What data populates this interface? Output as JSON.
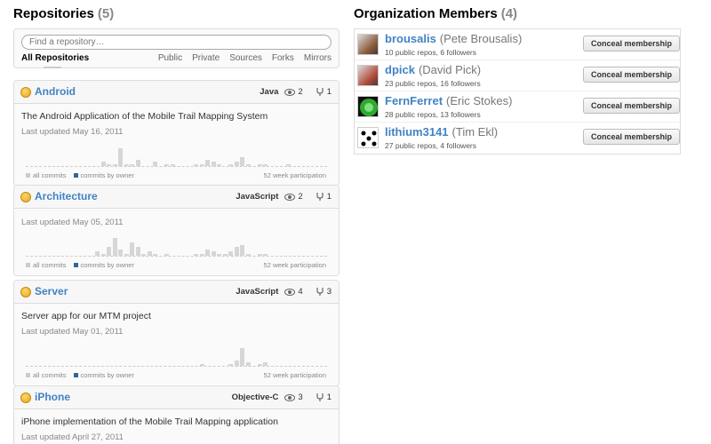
{
  "repositories": {
    "title": "Repositories",
    "count": "(5)",
    "filter_placeholder": "Find a repository…",
    "tabs": {
      "all": "All Repositories",
      "others": [
        "Public",
        "Private",
        "Sources",
        "Forks",
        "Mirrors"
      ]
    },
    "legend_all": "all commits",
    "legend_owner": "commits by owner",
    "participation_label": "52 week participation",
    "items": [
      {
        "name": "Android",
        "language": "Java",
        "watchers": "2",
        "forks": "1",
        "description": "The Android Application of the Mobile Trail Mapping System",
        "updated": "Last updated May 16, 2011",
        "participation": [
          0,
          0,
          0,
          0,
          0,
          0,
          0,
          0,
          0,
          0,
          0,
          0,
          0,
          2,
          1,
          1,
          8,
          1,
          1,
          3,
          0,
          0,
          2,
          0,
          1,
          1,
          0,
          0,
          0,
          1,
          1,
          3,
          2,
          1,
          0,
          1,
          2,
          4,
          1,
          0,
          1,
          1,
          0,
          0,
          0,
          1,
          0,
          0,
          0,
          0,
          0,
          0
        ]
      },
      {
        "name": "Architecture",
        "language": "JavaScript",
        "watchers": "2",
        "forks": "1",
        "description": "",
        "updated": "Last updated May 05, 2011",
        "participation": [
          0,
          0,
          0,
          0,
          0,
          0,
          0,
          0,
          0,
          0,
          0,
          0,
          2,
          1,
          4,
          8,
          3,
          1,
          6,
          4,
          1,
          2,
          1,
          0,
          1,
          0,
          0,
          0,
          0,
          1,
          1,
          3,
          2,
          1,
          1,
          2,
          4,
          5,
          1,
          0,
          1,
          1,
          0,
          0,
          0,
          0,
          0,
          0,
          0,
          0,
          0,
          0
        ]
      },
      {
        "name": "Server",
        "language": "JavaScript",
        "watchers": "4",
        "forks": "3",
        "description": "Server app for our MTM project",
        "updated": "Last updated May 01, 2011",
        "participation": [
          0,
          0,
          0,
          0,
          0,
          0,
          0,
          0,
          0,
          0,
          0,
          0,
          0,
          0,
          0,
          0,
          0,
          0,
          0,
          0,
          0,
          0,
          0,
          0,
          0,
          0,
          0,
          0,
          0,
          0,
          1,
          0,
          0,
          0,
          0,
          1,
          3,
          10,
          2,
          0,
          1,
          2,
          0,
          0,
          0,
          0,
          0,
          0,
          0,
          0,
          0,
          0
        ]
      },
      {
        "name": "iPhone",
        "language": "Objective-C",
        "watchers": "3",
        "forks": "1",
        "description": "iPhone implementation of the Mobile Trail Mapping application",
        "updated": "Last updated April 27, 2011",
        "participation": []
      }
    ]
  },
  "members": {
    "title": "Organization Members",
    "count": "(4)",
    "button_label": "Conceal membership",
    "items": [
      {
        "login": "brousalis",
        "full_name": "(Pete Brousalis)",
        "stats": "10 public repos, 6 followers",
        "avatar_color": "#8a5a3c"
      },
      {
        "login": "dpick",
        "full_name": "(David Pick)",
        "stats": "23 public repos, 16 followers",
        "avatar_color": "#b04a3a"
      },
      {
        "login": "FernFerret",
        "full_name": "(Eric Stokes)",
        "stats": "28 public repos, 13 followers",
        "avatar_color": "#2faa2f"
      },
      {
        "login": "lithium3141",
        "full_name": "(Tim Ekl)",
        "stats": "27 public repos, 4 followers",
        "avatar_color": "#ffffff"
      }
    ]
  }
}
